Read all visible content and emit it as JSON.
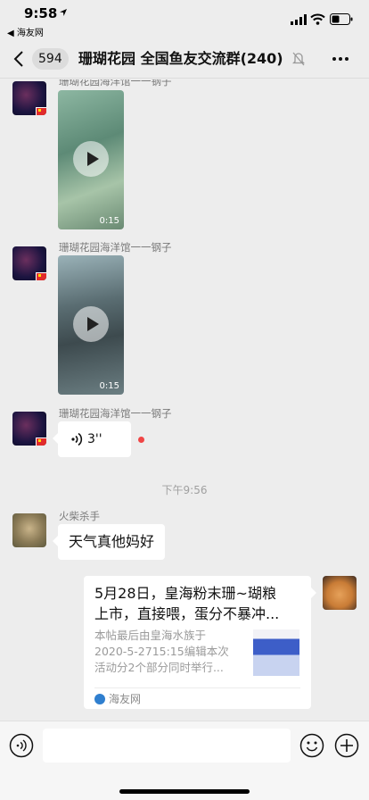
{
  "status_bar": {
    "time": "9:58",
    "back_app": "◀ 海友网"
  },
  "nav": {
    "unread_count": "594",
    "title": "珊瑚花园 全国鱼友交流群(240)"
  },
  "messages": {
    "video1": {
      "sender": "珊瑚花园海洋馆一一钢子",
      "duration": "0:15"
    },
    "video2": {
      "sender": "珊瑚花园海洋馆一一钢子",
      "duration": "0:15"
    },
    "voice": {
      "sender": "珊瑚花园海洋馆一一钢子",
      "length": "3''"
    },
    "time_divider": "下午9:56",
    "text": {
      "sender": "火柴杀手",
      "content": "天气真他妈好"
    },
    "link_card": {
      "title_line1": "5月28日，皇海粉末珊~瑚粮",
      "title_line2": "上市，直接喂，蛋分不暴冲...",
      "desc_line1": "本帖最后由皇海水族于",
      "desc_line2": "2020-5-2715:15编辑本次",
      "desc_line3": "活动分2个部分同时举行...",
      "source": "海友网"
    }
  },
  "colors": {
    "background": "#ededed",
    "bubble": "#ffffff",
    "unread_dot": "#f04545"
  },
  "icons": [
    "location-arrow-icon",
    "signal-icon",
    "wifi-icon",
    "battery-icon",
    "back-chevron-icon",
    "mute-bell-icon",
    "more-dots-icon",
    "play-icon",
    "voice-wave-icon",
    "voice-input-icon",
    "emoji-icon",
    "plus-icon"
  ]
}
